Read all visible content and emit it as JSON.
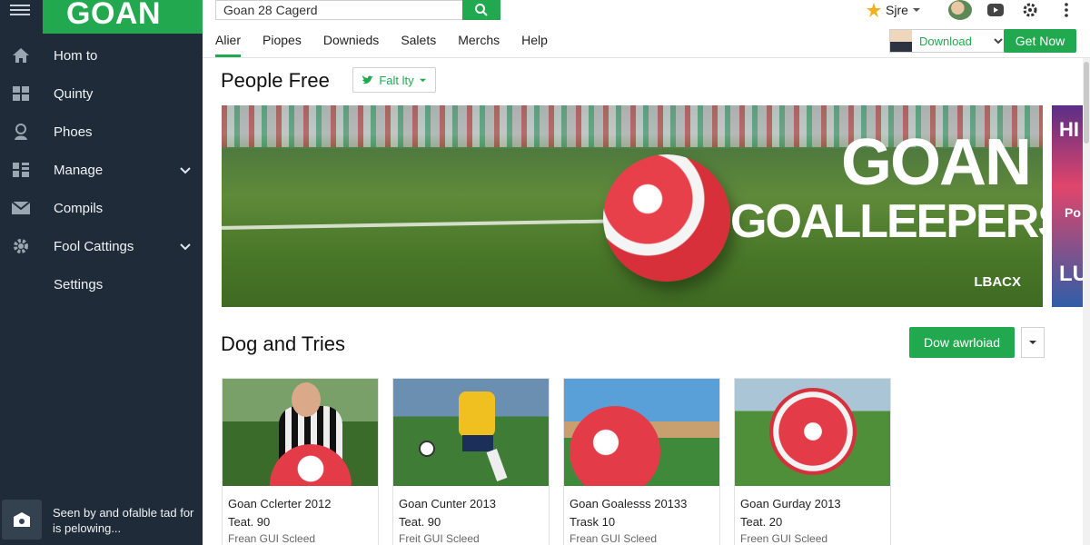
{
  "sidebar": {
    "logo": "GOAN",
    "items": [
      {
        "label": "Hom to",
        "icon": "home-icon"
      },
      {
        "label": "Quinty",
        "icon": "windows-icon"
      },
      {
        "label": "Phoes",
        "icon": "people-icon"
      },
      {
        "label": "Manage",
        "icon": "grid-icon",
        "has_chevron": true
      },
      {
        "label": "Compils",
        "icon": "mail-icon"
      },
      {
        "label": "Fool Cattings",
        "icon": "gear-icon",
        "has_chevron": true
      },
      {
        "label": "Settings",
        "icon": ""
      }
    ],
    "footer": {
      "text": "Seen by and ofalble tad for is pelowing...",
      "icon": "image-icon"
    }
  },
  "header": {
    "search": {
      "value": "Goan 28 Cagerd"
    },
    "tabs": [
      {
        "label": "Alier",
        "active": true
      },
      {
        "label": "Piopes"
      },
      {
        "label": "Downieds"
      },
      {
        "label": "Salets"
      },
      {
        "label": "Merchs"
      },
      {
        "label": "Help"
      }
    ],
    "user_label": "Sjre",
    "download_select": "Download",
    "cta": "Get Now"
  },
  "main": {
    "section1": {
      "title": "People Free",
      "filter": "Falt lty",
      "hero": {
        "title": "GOAN",
        "subtitle": "GOALLEEPERS",
        "brand": "LBACX",
        "side_text": [
          "HI",
          "Po",
          "LU"
        ]
      }
    },
    "section2": {
      "title": "Dog and Tries",
      "download_button": "Dow awrloiad",
      "cards": [
        {
          "title": "Goan Cclerter 2012",
          "sub": "Teat. 90",
          "meta": "Frean GUI Scleed"
        },
        {
          "title": "Goan Cunter 2013",
          "sub": "Teat. 90",
          "meta": "Freit GUI Scleed"
        },
        {
          "title": "Goan Goalesss 20133",
          "sub": "Trask 10",
          "meta": "Frean GUI Scleed"
        },
        {
          "title": "Goan Gurday 2013",
          "sub": "Teat. 20",
          "meta": "Freen GUI Scleed"
        }
      ]
    }
  },
  "colors": {
    "accent": "#22a94f",
    "sidebar_bg": "#1f2b38"
  }
}
